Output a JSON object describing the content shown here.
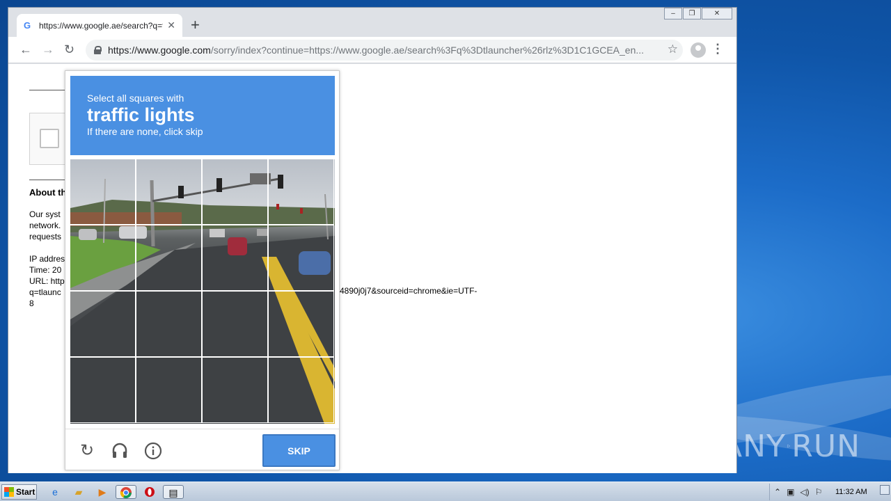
{
  "browser": {
    "tab_title": "https://www.google.ae/search?q=tl",
    "tab_favicon": "G",
    "url_host": "https://www.google.com",
    "url_path": "/sorry/index?continue=https://www.google.ae/search%3Fq%3Dtlauncher%26rlz%3D1C1GCEA_en..."
  },
  "page": {
    "about_heading": "About th",
    "para1": [
      "Our syst",
      "network.",
      "requests"
    ],
    "para2": [
      "IP addres",
      "Time: 20",
      "URL: http",
      "q=tlaunc",
      "8"
    ],
    "url_tail": "4890j0j7&sourceid=chrome&ie=UTF-"
  },
  "captcha": {
    "instruction_line1": "Select all squares with",
    "target": "traffic lights",
    "instruction_line3": "If there are none, click skip",
    "skip_label": "SKIP",
    "accent": "#4a90e2"
  },
  "watermark": {
    "left": "ANY",
    "right": "RUN"
  },
  "taskbar": {
    "start_label": "Start",
    "clock": "11:32 AM"
  }
}
